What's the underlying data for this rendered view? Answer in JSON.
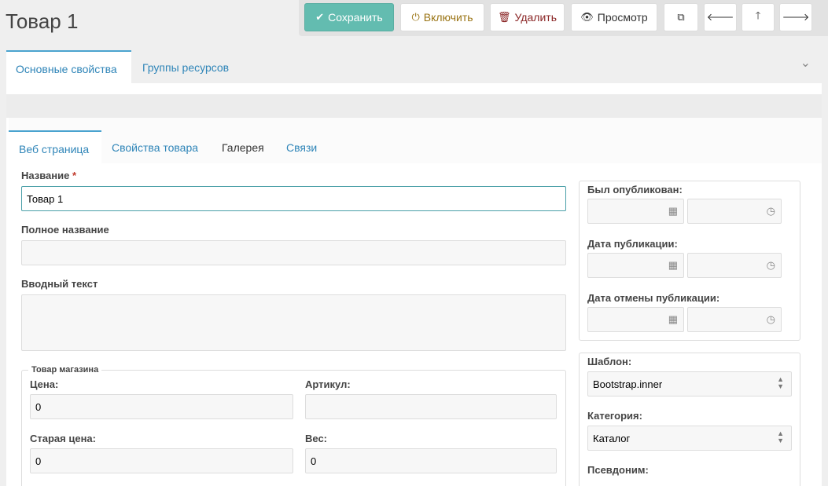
{
  "page_title": "Товар 1",
  "toolbar": {
    "save_label": "Сохранить",
    "enable_label": "Включить",
    "delete_label": "Удалить",
    "preview_label": "Просмотр",
    "icons": [
      "check-icon",
      "power-icon",
      "trash-icon",
      "eye-icon",
      "duplicate-icon",
      "arrow-left-icon",
      "arrow-up-icon",
      "arrow-right-icon"
    ]
  },
  "main_tabs": [
    "Основные свойства",
    "Группы ресурсов"
  ],
  "sub_tabs": [
    "Веб страница",
    "Свойства товара",
    "Галерея",
    "Связи"
  ],
  "form": {
    "name_label": "Название",
    "name_required_mark": "*",
    "name_value": "Товар 1",
    "fullname_label": "Полное название",
    "fullname_value": "",
    "intro_label": "Вводный текст",
    "intro_value": "",
    "shop_legend": "Товар магазина",
    "price_label": "Цена:",
    "price_value": "0",
    "article_label": "Артикул:",
    "article_value": "",
    "old_price_label": "Старая цена:",
    "old_price_value": "0",
    "weight_label": "Вес:",
    "weight_value": "0"
  },
  "dates": {
    "published_label": "Был опубликован:",
    "pubdate_label": "Дата публикации:",
    "unpubdate_label": "Дата отмены публикации:"
  },
  "settings": {
    "template_label": "Шаблон:",
    "template_value": "Bootstrap.inner",
    "category_label": "Категория:",
    "category_value": "Каталог",
    "alias_label": "Псевдоним:"
  },
  "colors": {
    "accent": "#4aa3cf",
    "save_button": "#63bcb0",
    "required": "#c0392b"
  }
}
